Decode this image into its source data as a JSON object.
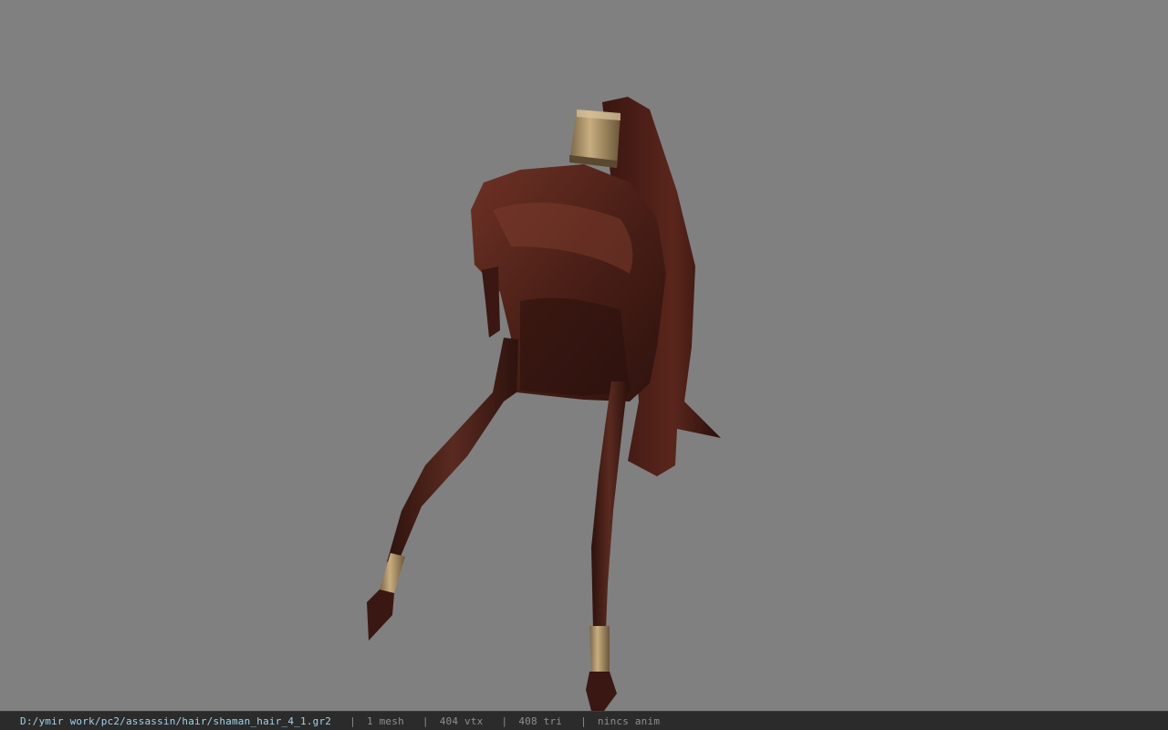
{
  "viewport": {
    "background_color": "#808080",
    "model_colors": {
      "hair_dark": "#3a1712",
      "hair_mid": "#5e2a20",
      "hair_light": "#7a3a2c",
      "metal_band": "#b49a6c"
    }
  },
  "status_bar": {
    "file_path": "D:/ymir work/pc2/assassin/hair/shaman_hair_4_1.gr2",
    "separator": "|",
    "mesh_count": "1 mesh",
    "vertex_count": "404 vtx",
    "triangle_count": "408 tri",
    "anim_status": "nincs anim"
  }
}
